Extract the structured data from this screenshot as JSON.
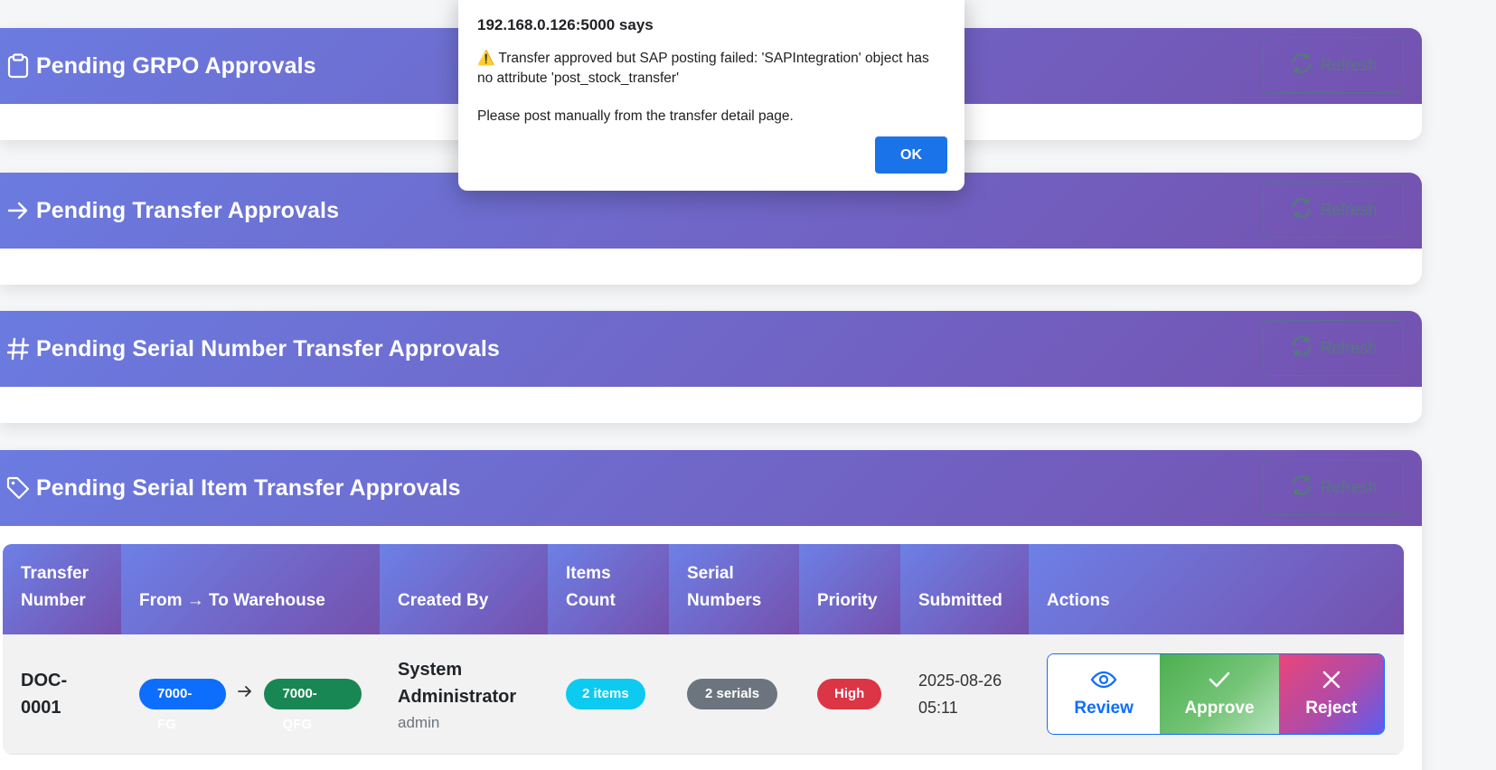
{
  "sections": [
    {
      "title": "Pending GRPO Approvals",
      "icon": "clipboard-icon",
      "refresh_label": "Refresh"
    },
    {
      "title": "Pending Transfer Approvals",
      "icon": "arrow-right-icon",
      "refresh_label": "Refresh"
    },
    {
      "title": "Pending Serial Number Transfer Approvals",
      "icon": "hash-icon",
      "refresh_label": "Refresh"
    },
    {
      "title": "Pending Serial Item Transfer Approvals",
      "icon": "tag-icon",
      "refresh_label": "Refresh"
    }
  ],
  "table": {
    "headers": [
      "Transfer Number",
      "From → To Warehouse",
      "Created By",
      "Items Count",
      "Serial Numbers",
      "Priority",
      "Submitted",
      "Actions"
    ],
    "rows": [
      {
        "doc_number": "DOC-0001",
        "from_warehouse": "7000-FG",
        "to_warehouse": "7000-QFG",
        "created_by_name": "System Administrator",
        "created_by_user": "admin",
        "items_count": "2 items",
        "serials": "2 serials",
        "priority": "High",
        "submitted": "2025-08-26 05:11",
        "actions": {
          "review": "Review",
          "approve": "Approve",
          "reject": "Reject"
        }
      }
    ]
  },
  "dialog": {
    "title": "192.168.0.126:5000 says",
    "message": "⚠️ Transfer approved but SAP posting failed: 'SAPIntegration' object has no attribute 'post_stock_transfer'",
    "message2": "Please post manually from the transfer detail page.",
    "ok_label": "OK"
  },
  "colors": {
    "header_gradient_start": "#6b7be0",
    "header_gradient_end": "#7452b0",
    "primary": "#0d6efd",
    "success": "#198754",
    "danger": "#dc3545",
    "info": "#0dcaf0",
    "secondary": "#6c757d"
  }
}
